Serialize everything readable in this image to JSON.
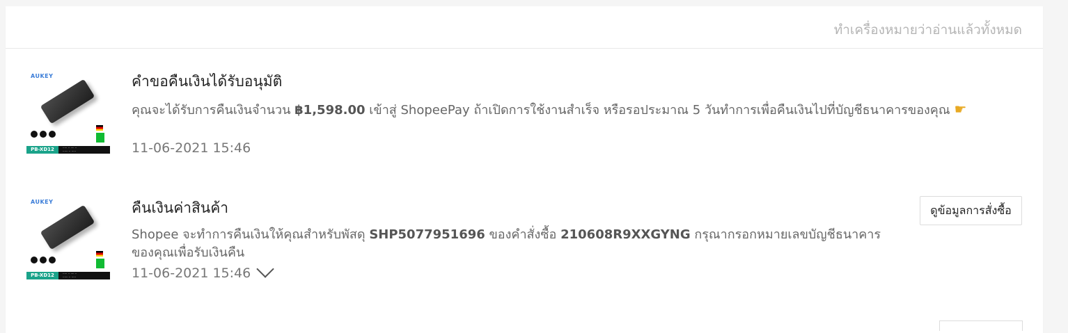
{
  "header": {
    "mark_all_read": "ทำเครื่องหมายว่าอ่านแล้วทั้งหมด"
  },
  "notifications": [
    {
      "title": "คำขอคืนเงินได้รับอนุมัติ",
      "desc_1": "คุณจะได้รับการคืนเงินจำนวน ",
      "amount": "฿1,598.00",
      "desc_2": " เข้าสู่ ShopeePay ถ้าเปิดการใช้งานสำเร็จ หรือรอประมาณ 5 วันทำการเพื่อคืนเงินไปที่บัญชีธนาคารของคุณ",
      "timestamp": "11-06-2021 15:46",
      "icon": "pointing-hand-emoji",
      "thumb_brand": "AUKEY",
      "thumb_model": "PB-XD12"
    },
    {
      "title": "คืนเงินค่าสินค้า",
      "desc_1": "Shopee จะทำการคืนเงินให้คุณสำหรับพัสดุ ",
      "parcel_id": "SHP5077951696",
      "desc_2": " ของคำสั่งซื้อ ",
      "order_id": "210608R9XXGYNG",
      "desc_3": " กรุณากรอกหมายเลขบัญชีธนาคารของคุณเพื่อรับเงินคืน",
      "timestamp": "11-06-2021 15:46",
      "button_label": "ดูข้อมูลการสั่งซื้อ",
      "thumb_brand": "AUKEY",
      "thumb_model": "PB-XD12"
    }
  ]
}
